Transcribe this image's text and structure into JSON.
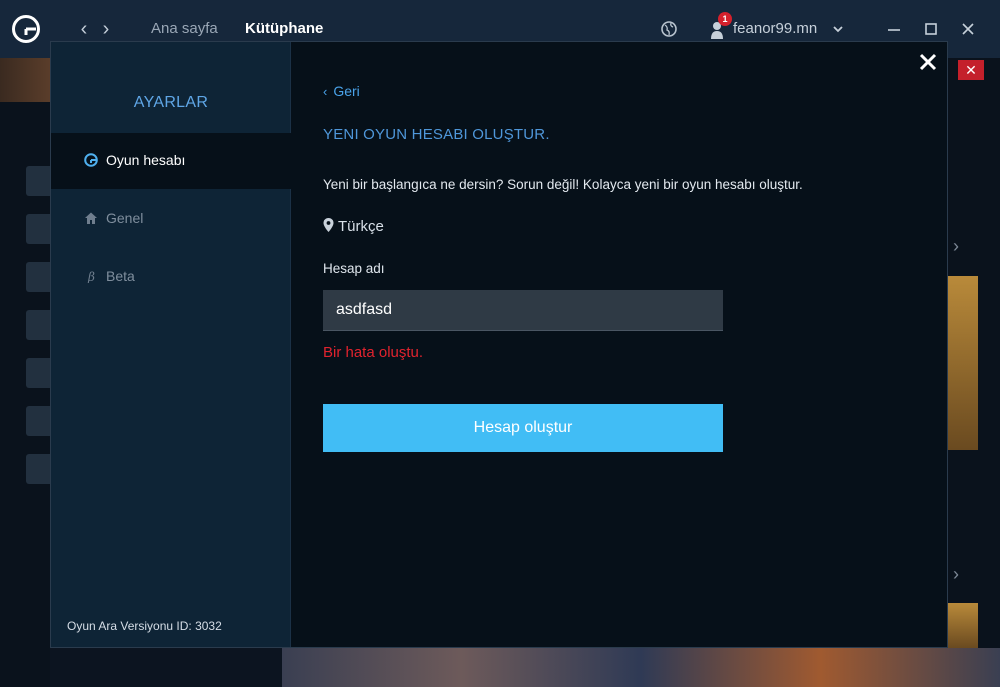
{
  "topbar": {
    "home_label": "Ana sayfa",
    "library_label": "Kütüphane",
    "username": "feanor99.mn",
    "notification_count": "1"
  },
  "settings": {
    "sidebar_title": "AYARLAR",
    "items": [
      {
        "label": "Oyun hesabı",
        "icon": "gameloop-logo-icon",
        "active": true
      },
      {
        "label": "Genel",
        "icon": "home-icon",
        "active": false
      },
      {
        "label": "Beta",
        "icon": "beta-icon",
        "active": false
      }
    ],
    "version_label": "Oyun Ara Versiyonu ID:",
    "version_id": "3032"
  },
  "dialog": {
    "back_label": "Geri",
    "title": "YENI OYUN HESABI OLUŞTUR.",
    "description": "Yeni bir başlangıca ne dersin? Sorun değil! Kolayca yeni bir oyun hesabı oluştur.",
    "region": "Türkçe",
    "field_label": "Hesap adı",
    "input_value": "asdfasd",
    "error_text": "Bir hata oluştu.",
    "create_button_label": "Hesap oluştur"
  },
  "colors": {
    "accent": "#41bdf5",
    "link": "#4aa3ea",
    "error": "#e0232e",
    "badge": "#d4202c"
  }
}
